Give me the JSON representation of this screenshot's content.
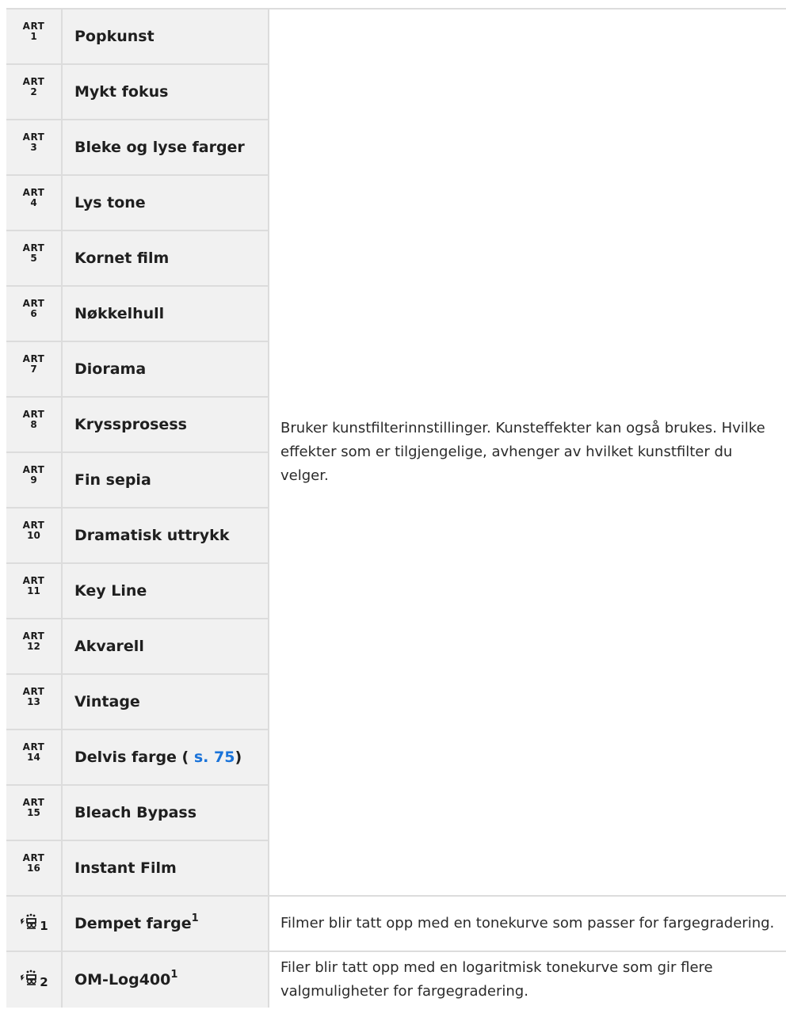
{
  "art_rows": [
    {
      "art_label": "ART",
      "num": "1",
      "name": "Popkunst"
    },
    {
      "art_label": "ART",
      "num": "2",
      "name": "Mykt fokus"
    },
    {
      "art_label": "ART",
      "num": "3",
      "name": "Bleke og lyse farger"
    },
    {
      "art_label": "ART",
      "num": "4",
      "name": "Lys tone"
    },
    {
      "art_label": "ART",
      "num": "5",
      "name": "Kornet film"
    },
    {
      "art_label": "ART",
      "num": "6",
      "name": "Nøkkelhull"
    },
    {
      "art_label": "ART",
      "num": "7",
      "name": "Diorama"
    },
    {
      "art_label": "ART",
      "num": "8",
      "name": "Kryssprosess"
    },
    {
      "art_label": "ART",
      "num": "9",
      "name": "Fin sepia"
    },
    {
      "art_label": "ART",
      "num": "10",
      "name": "Dramatisk uttrykk"
    },
    {
      "art_label": "ART",
      "num": "11",
      "name": "Key Line"
    },
    {
      "art_label": "ART",
      "num": "12",
      "name": "Akvarell"
    },
    {
      "art_label": "ART",
      "num": "13",
      "name": "Vintage"
    },
    {
      "art_label": "ART",
      "num": "14",
      "name": "Delvis farge (",
      "link": "s. 75",
      "suffix": ")"
    },
    {
      "art_label": "ART",
      "num": "15",
      "name": "Bleach Bypass"
    },
    {
      "art_label": "ART",
      "num": "16",
      "name": "Instant Film"
    }
  ],
  "art_description": "Bruker kunstfilterinnstillinger. Kunsteffekter kan også brukes. Hvilke effekter som er tilgjengelige, avhenger av hvilket kunstfilter du velger.",
  "movie_rows": [
    {
      "icon": "movie-effect-icon",
      "num": "1",
      "name": "Dempet farge",
      "footnote": "1",
      "description": "Filmer blir tatt opp med en tonekurve som passer for fargegradering."
    },
    {
      "icon": "movie-effect-icon",
      "num": "2",
      "name": "OM-Log400",
      "footnote": "1",
      "description": "Filer blir tatt opp med en logaritmisk tonekurve som gir flere valgmuligheter for fargegradering."
    }
  ],
  "colors": {
    "link": "#1a73d9",
    "cell_bg": "#f1f1f1",
    "border": "#dcdcdc"
  }
}
